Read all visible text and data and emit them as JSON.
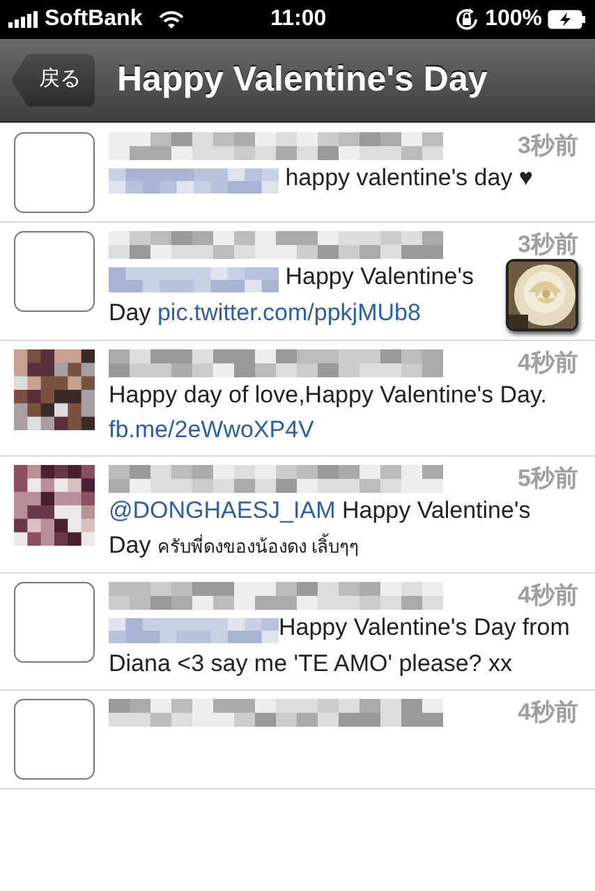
{
  "status_bar": {
    "carrier": "SoftBank",
    "time": "11:00",
    "battery": "100%"
  },
  "nav": {
    "back": "戻る",
    "title": "Happy Valentine's Day"
  },
  "tweets": [
    {
      "avatar": {
        "kind": "empty"
      },
      "time": "3秒前",
      "segments": [
        {
          "kind": "redacted"
        },
        {
          "kind": "text",
          "text": " happy valentine's day ♥"
        }
      ]
    },
    {
      "avatar": {
        "kind": "empty"
      },
      "time": "3秒前",
      "thumbnail": {
        "kind": "picture"
      },
      "segments": [
        {
          "kind": "redacted"
        },
        {
          "kind": "text",
          "text": " Happy Valentine's Day "
        },
        {
          "kind": "link",
          "text": "pic.twitter.com/ppkjMUb8"
        }
      ]
    },
    {
      "avatar": {
        "kind": "picture"
      },
      "time": "4秒前",
      "segments": [
        {
          "kind": "text",
          "text": "Happy day of love,Happy Valentine's Day. "
        },
        {
          "kind": "link",
          "text": "fb.me/2eWwoXP4V"
        }
      ]
    },
    {
      "avatar": {
        "kind": "picture"
      },
      "time": "5秒前",
      "segments": [
        {
          "kind": "link",
          "text": "@DONGHAESJ_IAM"
        },
        {
          "kind": "text",
          "text": " Happy Valentine's Day "
        },
        {
          "kind": "thai",
          "text": "ครับพี่ดงของน้องดง เลิ้บๆๆ"
        }
      ]
    },
    {
      "avatar": {
        "kind": "empty"
      },
      "time": "4秒前",
      "segments": [
        {
          "kind": "redacted"
        },
        {
          "kind": "text",
          "text": "Happy Valentine's Day from Diana <3 say me 'TE AMO' please? xx"
        }
      ]
    },
    {
      "avatar": {
        "kind": "empty"
      },
      "time": "4秒前"
    }
  ]
}
